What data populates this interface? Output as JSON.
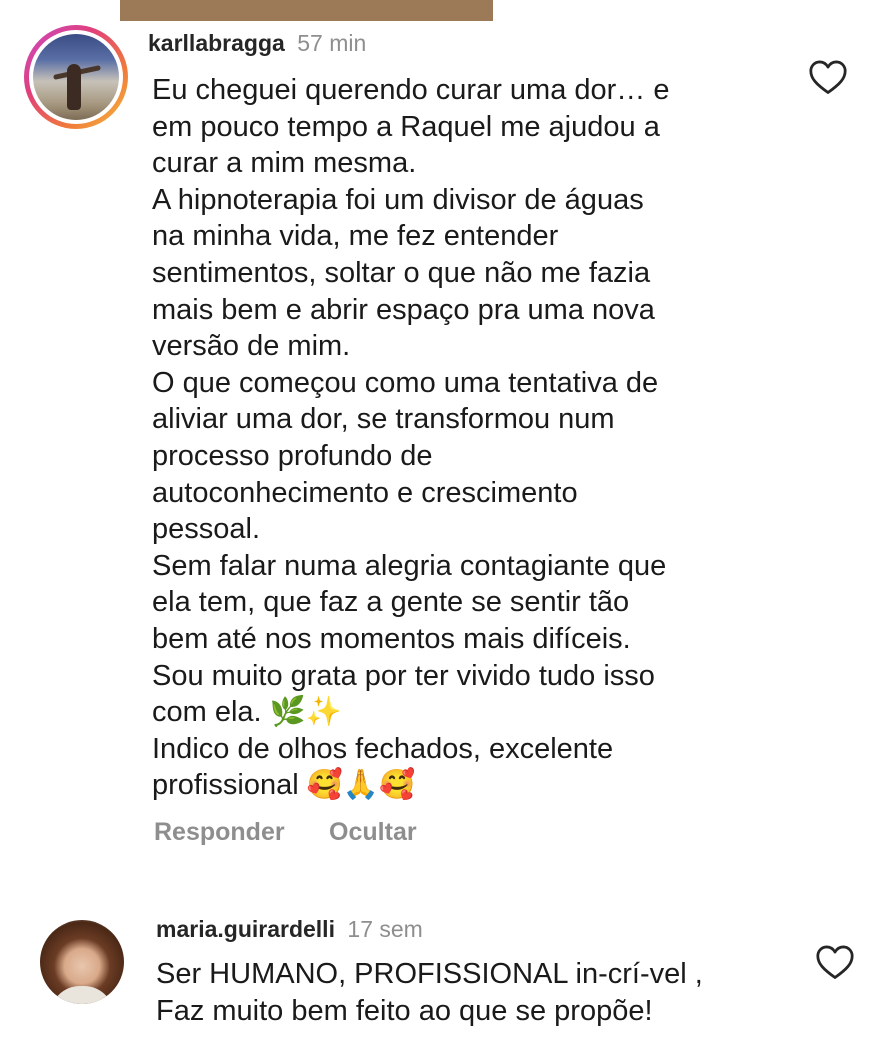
{
  "comments": [
    {
      "username": "karllabragga",
      "time": "57 min",
      "lines": [
        "Eu cheguei querendo curar uma dor… e",
        "em pouco tempo a Raquel me ajudou a",
        "curar a mim mesma.",
        "A hipnoterapia foi um divisor de águas",
        "na minha vida,  me fez entender",
        "sentimentos, soltar o que não me fazia",
        "mais bem e abrir espaço pra uma nova",
        "versão de mim.",
        "O que começou como uma tentativa de",
        "aliviar uma dor, se transformou num",
        "processo profundo de",
        "autoconhecimento e crescimento",
        "pessoal.",
        "Sem falar numa alegria contagiante que",
        "ela tem, que faz a gente se sentir tão",
        "bem até nos momentos mais difíceis.",
        "Sou muito grata por ter vivido tudo isso",
        "com ela. 🌿✨",
        "Indico de olhos fechados, excelente",
        "profissional 🥰🙏🥰"
      ],
      "reply_label": "Responder",
      "hide_label": "Ocultar",
      "like_icon": "heart-outline-icon"
    },
    {
      "username": "maria.guirardelli",
      "time": "17 sem",
      "lines": [
        "Ser HUMANO, PROFISSIONAL in-crí-vel ,",
        "Faz muito bem feito ao que se propõe!"
      ],
      "like_icon": "heart-outline-icon"
    }
  ],
  "colors": {
    "top_bar": "#9c7a58",
    "meta_gray": "#8e8e8e",
    "story_ring": [
      "#c84ac8",
      "#e0407a",
      "#f07a3a",
      "#f4c040"
    ]
  }
}
